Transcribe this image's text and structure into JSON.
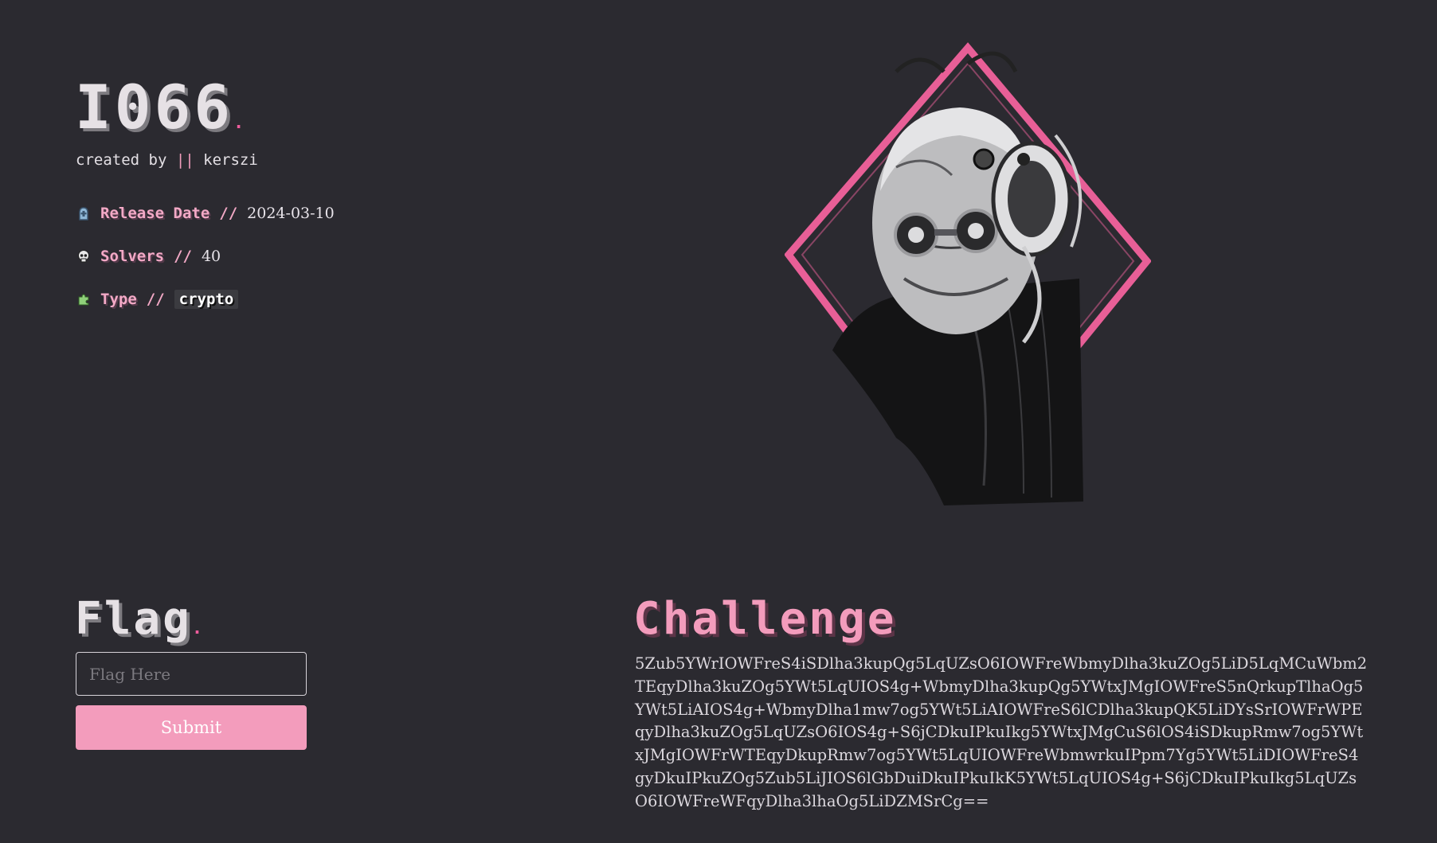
{
  "header": {
    "title": "I066",
    "title_dot": ".",
    "created_by_label": "created by ",
    "created_by_sep": "||",
    "author": " kerszi"
  },
  "meta": {
    "release_date": {
      "icon": "tombstone-icon",
      "label": "Release Date",
      "sep": "//",
      "value": "2024-03-10"
    },
    "solvers": {
      "icon": "skull-icon",
      "label": "Solvers",
      "sep": "//",
      "value": "40"
    },
    "type": {
      "icon": "puzzle-icon",
      "label": "Type",
      "sep": "//",
      "value": "crypto"
    }
  },
  "portrait": {
    "alt": "cyborg-portrait-image"
  },
  "flag": {
    "title": "Flag",
    "title_dot": ".",
    "input_placeholder": "Flag Here",
    "input_value": "",
    "submit_label": "Submit"
  },
  "challenge": {
    "title": "Challenge",
    "text": "5Zub5YWrIOWFreS4iSDlha3kupQg5LqUZsO6IOWFreWbmyDlha3kuZOg5LiD5LqMCuWbm2TEqyDlha3kuZOg5YWt5LqUIOS4g+WbmyDlha3kupQg5YWtxJMgIOWFreS5nQrkupTlhaOg5YWt5LiAIOS4g+WbmyDlha1mw7og5YWt5LiAIOWFreS6lCDlha3kupQK5LiDYsSrIOWFrWPEqyDlha3kuZOg5LqUZsO6IOS4g+S6jCDkuIPkuIkg5YWtxJMgCuS6lOS4iSDkupRmw7og5YWtxJMgIOWFrWTEqyDkupRmw7og5YWt5LqUIOWFreWbmwrkuIPpm7Yg5YWt5LiDIOWFreS4gyDkuIPkuZOg5Zub5LiJIOS6lGbDuiDkuIPkuIkK5YWt5LqUIOS4g+S6jCDkuIPkuIkg5LqUZsO6IOWFreWFqyDlha3lhaOg5LiDZMSrCg=="
  },
  "colors": {
    "background": "#2b2a30",
    "accent_pink": "#f39cbc",
    "text": "#e8e4ea"
  }
}
